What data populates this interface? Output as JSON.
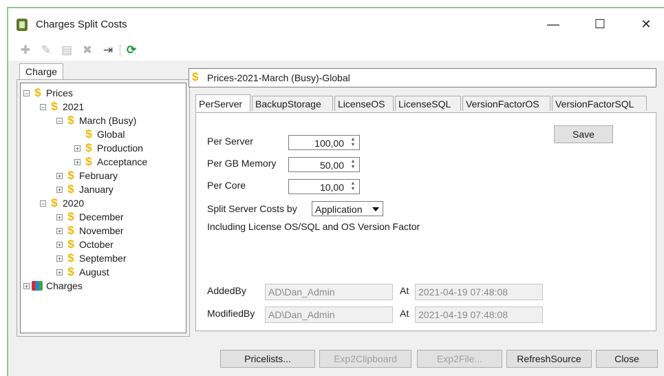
{
  "window": {
    "title": "Charges Split Costs",
    "controls": {
      "minimize": "—",
      "maximize": "☐",
      "close": "✕"
    }
  },
  "toolbar": {
    "icons": [
      "add-icon",
      "edit-icon",
      "save-icon",
      "delete-icon",
      "export-icon",
      "refresh-icon"
    ]
  },
  "left_tab": {
    "label": "Charge"
  },
  "tree": {
    "prices": "Prices",
    "y2021": "2021",
    "march": "March (Busy)",
    "global": "Global",
    "production": "Production",
    "acceptance": "Acceptance",
    "february": "February",
    "january": "January",
    "y2020": "2020",
    "december": "December",
    "november": "November",
    "october": "October",
    "september": "September",
    "august": "August",
    "charges": "Charges"
  },
  "header": {
    "path": "Prices-2021-March (Busy)-Global"
  },
  "tabs": [
    "PerServer",
    "BackupStorage",
    "LicenseOS",
    "LicenseSQL",
    "VersionFactorOS",
    "VersionFactorSQL"
  ],
  "form": {
    "per_server_label": "Per Server",
    "per_server_value": "100,00",
    "per_gb_label": "Per GB Memory",
    "per_gb_value": "50,00",
    "per_core_label": "Per Core",
    "per_core_value": "10,00",
    "split_label": "Split Server Costs by",
    "split_value": "Application",
    "note": "Including License OS/SQL and OS Version Factor",
    "save_label": "Save",
    "added_by_label": "AddedBy",
    "added_by_value": "AD\\Dan_Admin",
    "added_at_label": "At",
    "added_at_value": "2021-04-19 07:48:08",
    "modified_by_label": "ModifiedBy",
    "modified_by_value": "AD\\Dan_Admin",
    "modified_at_label": "At",
    "modified_at_value": "2021-04-19 07:48:08"
  },
  "bottom": {
    "pricelists": "Pricelists...",
    "exp2clipboard": "Exp2Clipboard",
    "exp2file": "Exp2File...",
    "refresh": "RefreshSource",
    "close": "Close"
  },
  "colors": {
    "accent_green": "#8fc98a",
    "dollar": "#f2b705"
  }
}
